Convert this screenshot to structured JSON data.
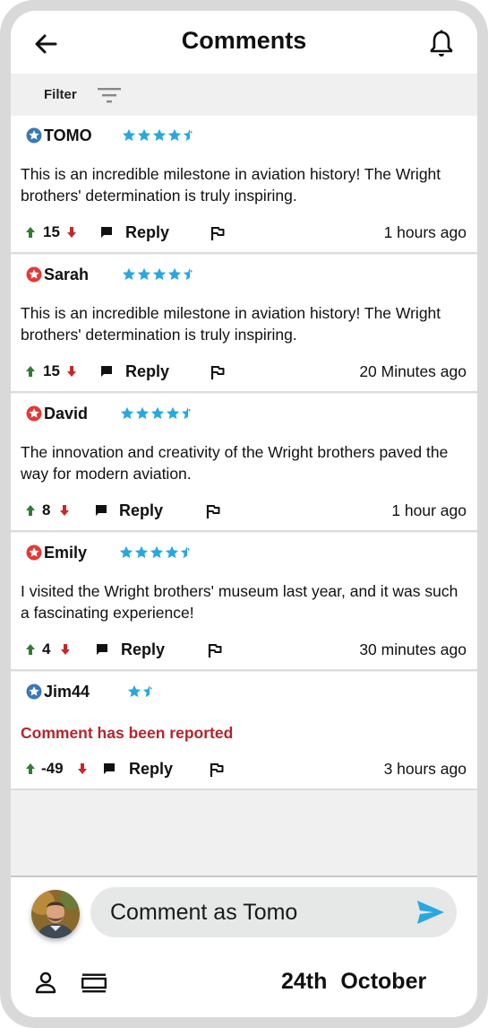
{
  "header": {
    "title": "Comments"
  },
  "filter": {
    "label": "Filter"
  },
  "colors": {
    "upvote": "#2e7d32",
    "downvote": "#c62828",
    "star": "#29a8e0",
    "badge_blue": "#3a78b8",
    "badge_red": "#e53935",
    "reported": "#b3262d",
    "send": "#29a8e0"
  },
  "comments": [
    {
      "user": "TOMO",
      "badge": "blue",
      "rating": 4.5,
      "text": "This is an incredible milestone in aviation history! The Wright brothers' determination is truly inspiring.",
      "score": "15",
      "reply_label": "Reply",
      "time": "1 hours ago"
    },
    {
      "user": "Sarah",
      "badge": "red",
      "rating": 4.5,
      "text": "This is an incredible milestone in aviation history! The Wright brothers' determination is truly inspiring.",
      "score": "15",
      "reply_label": "Reply",
      "time": "20 Minutes ago"
    },
    {
      "user": "David",
      "badge": "red",
      "rating": 4.5,
      "text": "The innovation and creativity of the Wright brothers paved the way for modern aviation.",
      "score": "8",
      "reply_label": "Reply",
      "time": "1 hour ago"
    },
    {
      "user": "Emily",
      "badge": "red",
      "rating": 4.5,
      "text": "I visited the Wright brothers' museum last year, and it was such a fascinating experience!",
      "score": "4",
      "reply_label": "Reply",
      "time": "30 minutes ago"
    },
    {
      "user": "Jim44",
      "badge": "blue",
      "rating": 1.5,
      "text": "Comment has been reported",
      "reported": true,
      "score": "-49",
      "reply_label": "Reply",
      "time": "3 hours ago"
    }
  ],
  "composer": {
    "placeholder": "Comment as Tomo"
  },
  "footer": {
    "date": "24th October"
  }
}
